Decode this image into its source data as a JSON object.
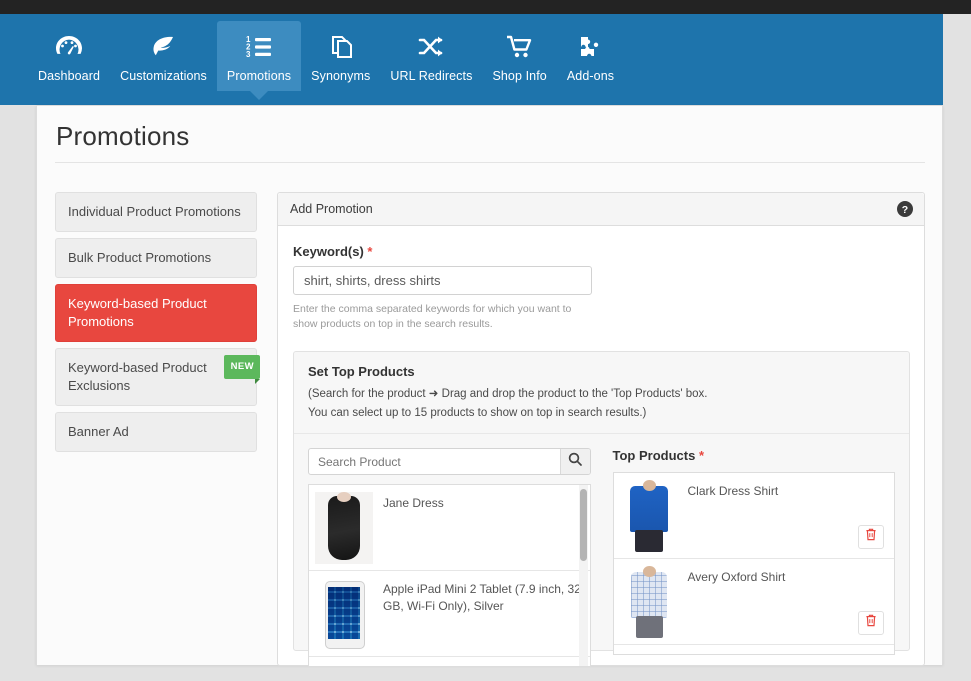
{
  "colors": {
    "nav_blue": "#1e74ac",
    "nav_active_blue": "#3d8cc0",
    "accent_red": "#e8473f",
    "badge_green": "#5cb85c",
    "top_strip": "#232323"
  },
  "nav": {
    "items": [
      {
        "label": "Dashboard",
        "icon": "dashboard-icon",
        "active": false
      },
      {
        "label": "Customizations",
        "icon": "leaf-icon",
        "active": false
      },
      {
        "label": "Promotions",
        "icon": "ordered-list-icon",
        "active": true
      },
      {
        "label": "Synonyms",
        "icon": "copy-pages-icon",
        "active": false
      },
      {
        "label": "URL Redirects",
        "icon": "shuffle-icon",
        "active": false
      },
      {
        "label": "Shop Info",
        "icon": "shopping-cart-icon",
        "active": false
      },
      {
        "label": "Add-ons",
        "icon": "puzzle-piece-icon",
        "active": false
      }
    ]
  },
  "page": {
    "title": "Promotions"
  },
  "submenu": {
    "items": [
      {
        "label": "Individual Product Promotions",
        "active": false,
        "badge": null
      },
      {
        "label": "Bulk Product Promotions",
        "active": false,
        "badge": null
      },
      {
        "label": "Keyword-based Product Promotions",
        "active": true,
        "badge": null
      },
      {
        "label": "Keyword-based Product Exclusions",
        "active": false,
        "badge": "NEW"
      },
      {
        "label": "Banner Ad",
        "active": false,
        "badge": null
      }
    ]
  },
  "panel": {
    "title": "Add Promotion",
    "help_icon": "question-circle-icon",
    "keyword": {
      "label": "Keyword(s)",
      "required_marker": "*",
      "value": "shirt, shirts, dress shirts",
      "placeholder": "shirt, shirts, dress shirts",
      "help_text": "Enter the comma separated keywords for which you want to show products on top in the search results."
    },
    "set_top_products": {
      "title": "Set Top Products",
      "line1": "(Search for the product ➜ Drag and drop the product to the 'Top Products' box.",
      "line2": "You can select up to 15 products to show on top in search results.)",
      "search": {
        "placeholder": "Search Product",
        "value": "",
        "button_icon": "search-icon"
      },
      "search_results": [
        {
          "name": "Jane Dress",
          "thumb": "dress-thumbnail"
        },
        {
          "name": "Apple iPad Mini 2 Tablet (7.9 inch, 32 GB, Wi-Fi Only), Silver",
          "thumb": "ipad-thumbnail"
        }
      ],
      "top_products": {
        "label": "Top Products",
        "required_marker": "*",
        "items": [
          {
            "name": "Clark Dress Shirt",
            "thumb": "blue-shirt-thumbnail",
            "delete_icon": "trash-icon"
          },
          {
            "name": "Avery Oxford Shirt",
            "thumb": "oxford-shirt-thumbnail",
            "delete_icon": "trash-icon"
          }
        ]
      }
    }
  }
}
